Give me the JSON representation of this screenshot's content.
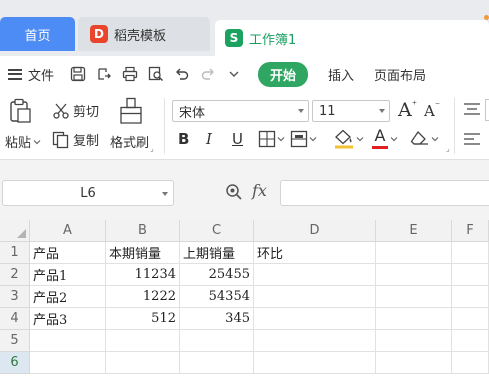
{
  "tabs": {
    "home": "首页",
    "template": "稻壳模板",
    "workbook": "工作簿1",
    "template_logo": "D",
    "workbook_logo": "S"
  },
  "menu": {
    "file": "文件",
    "start": "开始",
    "insert": "插入",
    "page_layout": "页面布局"
  },
  "ribbon": {
    "paste": "粘贴",
    "cut": "剪切",
    "copy": "复制",
    "format_painter": "格式刷",
    "font_name": "宋体",
    "font_size": "11",
    "bold": "B",
    "italic": "I",
    "underline": "U",
    "font_color_letter": "A",
    "increase_font": "A",
    "decrease_font": "A"
  },
  "formula_bar": {
    "name_box": "L6",
    "fx_label": "fx",
    "formula": ""
  },
  "sheet": {
    "columns": [
      "A",
      "B",
      "C",
      "D",
      "E",
      "F"
    ],
    "rows": [
      "1",
      "2",
      "3",
      "4",
      "5",
      "6"
    ],
    "cells": [
      [
        "产品",
        "本期销量",
        "上期销量",
        "环比",
        "",
        ""
      ],
      [
        "产品1",
        "11234",
        "25455",
        "",
        "",
        ""
      ],
      [
        "产品2",
        "1222",
        "54354",
        "",
        "",
        ""
      ],
      [
        "产品3",
        "512",
        "345",
        "",
        "",
        ""
      ],
      [
        "",
        "",
        "",
        "",
        "",
        ""
      ],
      [
        "",
        "",
        "",
        "",
        "",
        ""
      ]
    ],
    "active_row": "6"
  },
  "colors": {
    "accent_green": "#2fa661",
    "home_tab_blue": "#4e8cf5",
    "selection_green": "#1f9c55"
  }
}
